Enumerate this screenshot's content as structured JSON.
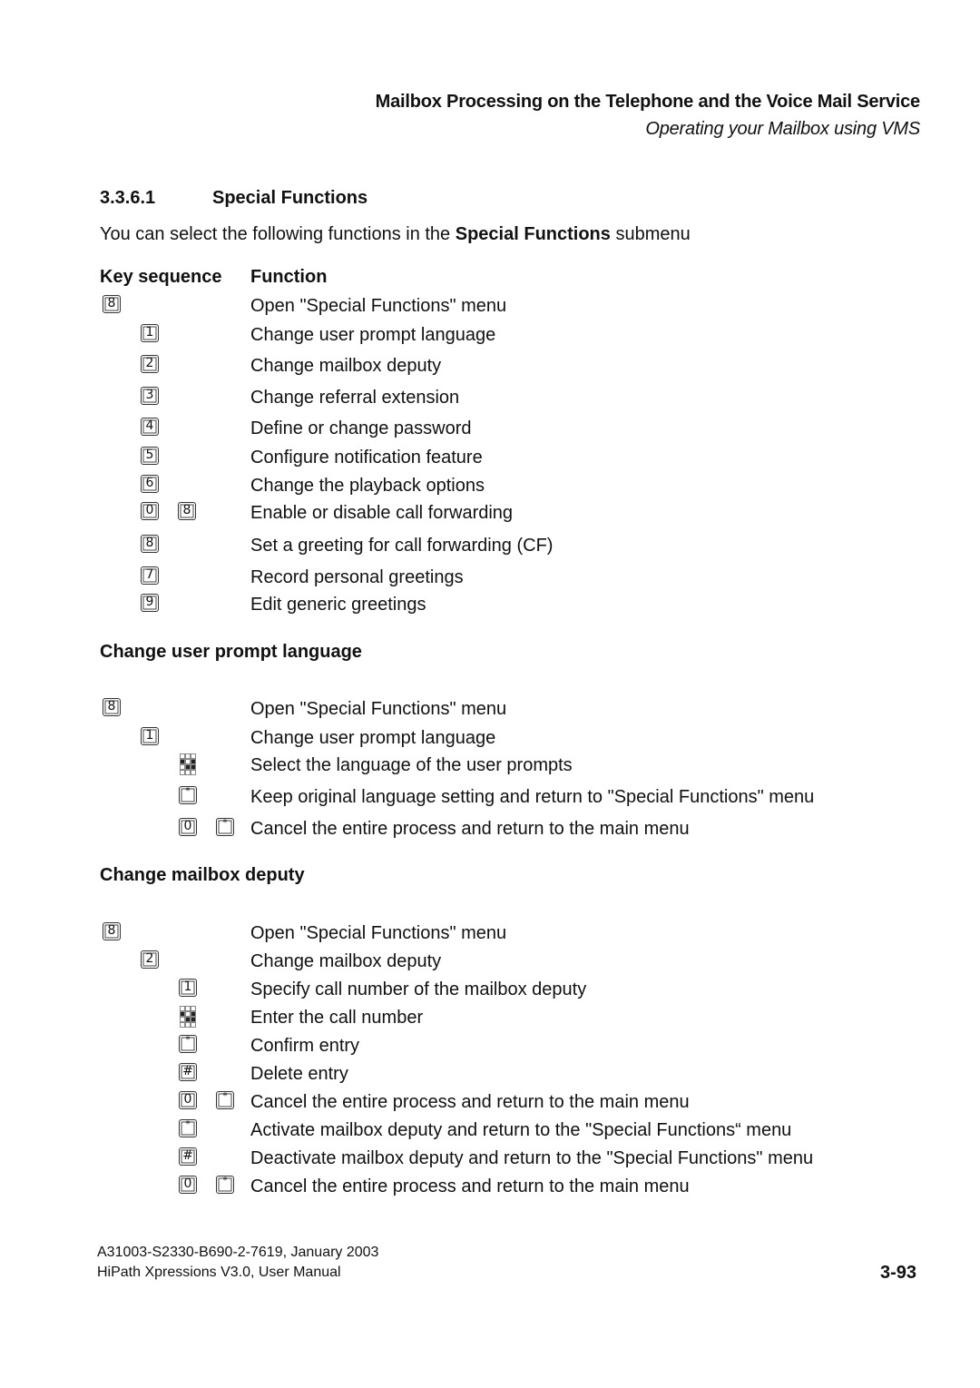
{
  "header": {
    "title": "Mailbox Processing on the Telephone and the Voice Mail Service",
    "subtitle": "Operating your Mailbox using VMS"
  },
  "section": {
    "number": "3.3.6.1",
    "title": "Special Functions",
    "intro_pre": "You can select the following functions in the ",
    "intro_bold": "Special Functions",
    "intro_post": " submenu"
  },
  "table": {
    "col_key": "Key sequence",
    "col_function": "Function",
    "rows": [
      {
        "keys": [
          "8"
        ],
        "level": 0,
        "desc": "Open \"Special Functions\" menu"
      },
      {
        "keys": [
          "1"
        ],
        "level": 1,
        "desc": "Change user prompt language"
      },
      {
        "keys": [
          "2"
        ],
        "level": 1,
        "desc": "Change mailbox deputy"
      },
      {
        "keys": [
          "3"
        ],
        "level": 1,
        "desc": "Change referral extension"
      },
      {
        "keys": [
          "4"
        ],
        "level": 1,
        "desc": "Define or change password"
      },
      {
        "keys": [
          "5"
        ],
        "level": 1,
        "desc": "Configure notification feature"
      },
      {
        "keys": [
          "6"
        ],
        "level": 1,
        "desc": "Change the playback options"
      },
      {
        "keys": [
          "0",
          "8"
        ],
        "level": 1,
        "desc": "Enable or disable call forwarding"
      },
      {
        "keys": [
          "8"
        ],
        "level": 1,
        "desc": "Set a greeting for call forwarding (CF)"
      },
      {
        "keys": [
          "7"
        ],
        "level": 1,
        "desc": "Record personal greetings"
      },
      {
        "keys": [
          "9"
        ],
        "level": 1,
        "desc": "Edit generic greetings"
      }
    ]
  },
  "prompt_language": {
    "heading": "Change user prompt language",
    "rows": [
      {
        "keys": [
          "8"
        ],
        "level": 0,
        "desc": "Open \"Special Functions\" menu"
      },
      {
        "keys": [
          "1"
        ],
        "level": 1,
        "desc": "Change user prompt language"
      },
      {
        "keys": [
          "keypad"
        ],
        "level": 2,
        "desc": "Select the language of the user prompts"
      },
      {
        "keys": [
          "*"
        ],
        "level": 2,
        "desc": "Keep original language setting and return to \"Special Functions\" menu"
      },
      {
        "keys": [
          "0",
          "*"
        ],
        "level": 2,
        "desc": "Cancel the entire process and return to the main menu"
      }
    ]
  },
  "mailbox_deputy": {
    "heading": "Change mailbox deputy",
    "rows": [
      {
        "keys": [
          "8"
        ],
        "level": 0,
        "desc": "Open \"Special Functions\" menu"
      },
      {
        "keys": [
          "2"
        ],
        "level": 1,
        "desc": "Change mailbox deputy"
      },
      {
        "keys": [
          "1"
        ],
        "level": 2,
        "desc": "Specify call number of the mailbox deputy"
      },
      {
        "keys": [
          "keypad"
        ],
        "level": 2,
        "desc": "Enter the call number"
      },
      {
        "keys": [
          "*"
        ],
        "level": 2,
        "desc": "Confirm entry"
      },
      {
        "keys": [
          "#"
        ],
        "level": 2,
        "desc": "Delete entry"
      },
      {
        "keys": [
          "0",
          "*"
        ],
        "level": 2,
        "desc": "Cancel the entire process and return to the main menu"
      },
      {
        "keys": [
          "*"
        ],
        "level": 2,
        "desc": "Activate mailbox deputy and return to the \"Special Functions“ menu"
      },
      {
        "keys": [
          "#"
        ],
        "level": 2,
        "desc": "Deactivate mailbox deputy and return to the \"Special Functions\" menu"
      },
      {
        "keys": [
          "0",
          "*"
        ],
        "level": 2,
        "desc": "Cancel the entire process and return to the main menu"
      }
    ]
  },
  "footer": {
    "doc_id": "A31003-S2330-B690-2-7619, January 2003",
    "manual": "HiPath Xpressions V3.0, User Manual",
    "page": "3-93"
  }
}
